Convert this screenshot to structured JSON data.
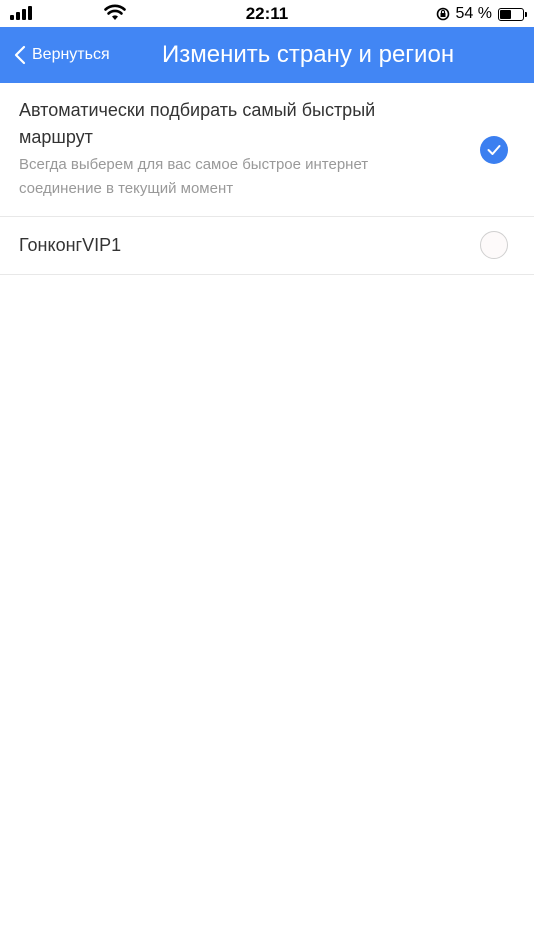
{
  "status_bar": {
    "time": "22:11",
    "battery_text": "54 %",
    "battery_level": 0.54,
    "icons": [
      "signal-icon",
      "wifi-icon",
      "orientation-lock-icon",
      "battery-icon"
    ]
  },
  "nav": {
    "back_label": "Вернуться",
    "title": "Изменить страну и регион",
    "color": "#4286f4"
  },
  "options": [
    {
      "title": "Автоматически подбирать самый быстрый маршрут",
      "subtitle": "Всегда выберем для вас самое быстрое интернет соединение в текущий момент",
      "selected": true
    },
    {
      "title": "ГонконгVIP1",
      "selected": false
    }
  ]
}
